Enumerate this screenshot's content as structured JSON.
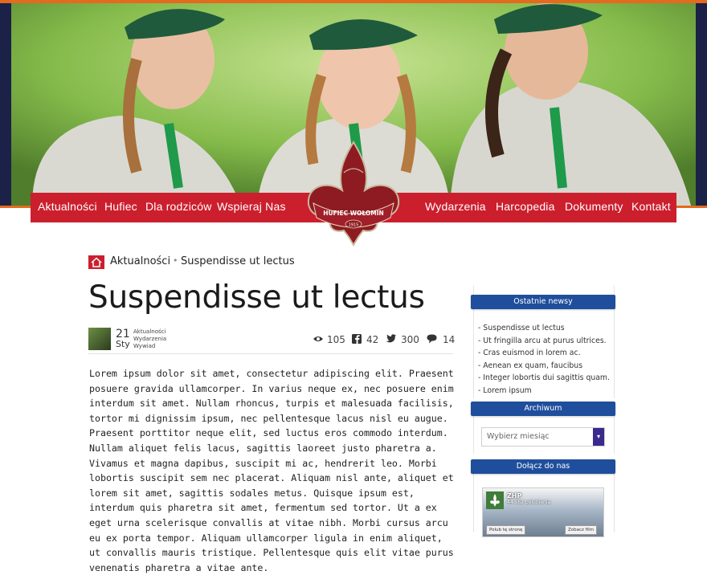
{
  "nav": {
    "items": [
      "Aktualności",
      "Hufiec",
      "Dla rodziców",
      "Wspieraj Nas",
      "Wydarzenia",
      "Harcopedia",
      "Dokumenty",
      "Kontakt"
    ]
  },
  "logo": {
    "line1": "HUFIEC WOŁOMIN",
    "year": "1915"
  },
  "breadcrumb": {
    "section": "Aktualności",
    "separator": "•",
    "current": "Suspendisse ut lectus"
  },
  "article": {
    "title": "Suspendisse ut lectus",
    "date_day": "21",
    "date_month": "Sty",
    "categories": [
      "Aktualności",
      "Wydarzenia",
      "Wywiad"
    ],
    "stats": {
      "views": "105",
      "facebook": "42",
      "twitter": "300",
      "comments": "14"
    },
    "body": "Lorem ipsum dolor sit amet, consectetur adipiscing elit. Praesent posuere gravida ullamcorper. In varius neque ex, nec posuere enim interdum sit amet. Nullam rhoncus, turpis et malesuada facilisis, tortor mi dignissim ipsum, nec pellentesque lacus nisl eu augue. Praesent porttitor neque elit, sed luctus eros commodo interdum. Nullam aliquet felis lacus, sagittis laoreet justo pharetra a. Vivamus et magna dapibus, suscipit mi ac, hendrerit leo. Morbi lobortis suscipit sem nec placerat. Aliquam nisl ante, aliquet et lorem sit amet, sagittis sodales metus. Quisque ipsum est, interdum quis pharetra sit amet, fermentum sed tortor. Ut a ex eget urna scelerisque convallis at vitae nibh. Morbi cursus arcu eu ex porta tempor. Aliquam ullamcorper ligula in enim aliquet, ut convallis mauris tristique. Pellentesque quis elit vitae purus venenatis pharetra a vitae ante."
  },
  "sidebar": {
    "news_title": "Ostatnie newsy",
    "news": [
      "- Suspendisse ut lectus",
      "- Ut fringilla arcu at purus ultrices.",
      "- Cras euismod in lorem ac.",
      "- Aenean ex quam, faucibus",
      "- Integer lobortis dui sagittis quam.",
      "- Lorem ipsum"
    ],
    "archive_title": "Archiwum",
    "archive_placeholder": "Wybierz miesiąc",
    "join_title": "Dołącz do nas",
    "fb": {
      "name": "ZHP",
      "fans": "44 562 polubienia",
      "like_btn": "Polub tę stronę",
      "view_btn": "Zobacz film"
    }
  },
  "colors": {
    "accent_red": "#cc1f2e",
    "accent_orange": "#e36a1e",
    "sidebar_blue": "#1f4e9c",
    "logo_maroon": "#8e1b22"
  }
}
